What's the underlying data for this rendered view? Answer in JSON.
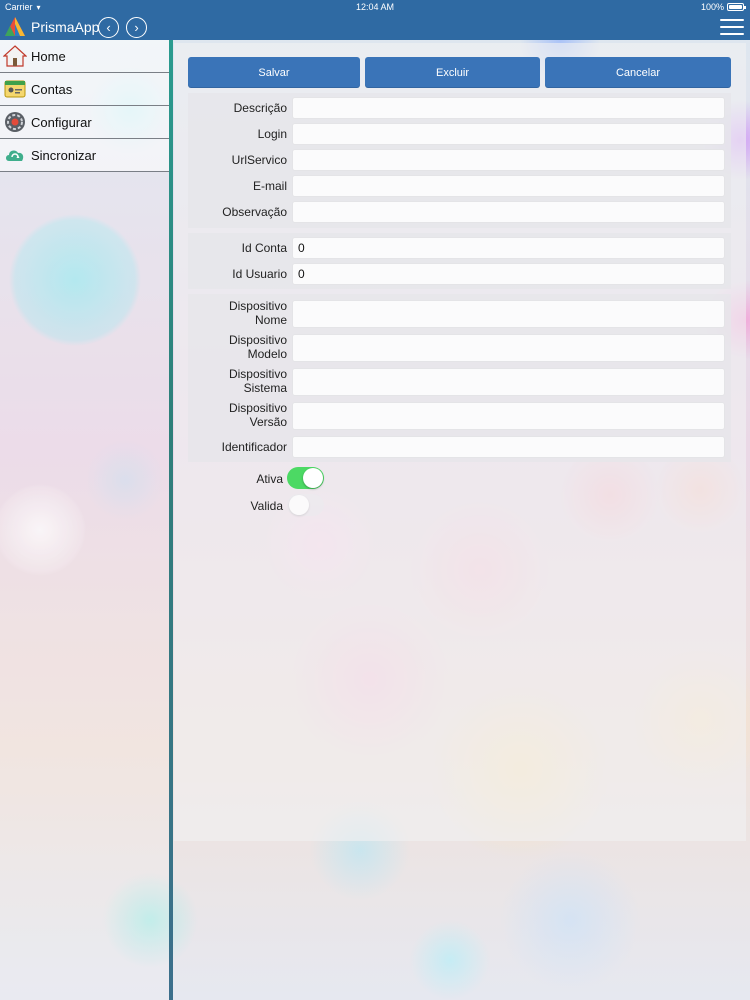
{
  "status_bar": {
    "carrier": "Carrier",
    "time": "12:04 AM",
    "battery": "100%"
  },
  "nav_bar": {
    "title": "PrismaApp"
  },
  "sidebar": {
    "items": [
      {
        "label": "Home",
        "icon": "home-icon"
      },
      {
        "label": "Contas",
        "icon": "accounts-icon"
      },
      {
        "label": "Configurar",
        "icon": "settings-icon"
      },
      {
        "label": "Sincronizar",
        "icon": "cloud-sync-icon"
      }
    ]
  },
  "toolbar": {
    "save_label": "Salvar",
    "delete_label": "Excluir",
    "cancel_label": "Cancelar"
  },
  "form": {
    "account": [
      {
        "label": "Descrição",
        "value": ""
      },
      {
        "label": "Login",
        "value": ""
      },
      {
        "label": "UrlServico",
        "value": ""
      },
      {
        "label": "E-mail",
        "value": ""
      },
      {
        "label": "Observação",
        "value": ""
      }
    ],
    "ids": [
      {
        "label": "Id Conta",
        "value": "0"
      },
      {
        "label": "Id Usuario",
        "value": "0"
      }
    ],
    "device": [
      {
        "label_line1": "Dispositivo",
        "label_line2": "Nome",
        "value": ""
      },
      {
        "label_line1": "Dispositivo",
        "label_line2": "Modelo",
        "value": ""
      },
      {
        "label_line1": "Dispositivo",
        "label_line2": "Sistema",
        "value": ""
      },
      {
        "label_line1": "Dispositivo",
        "label_line2": "Versão",
        "value": ""
      }
    ],
    "identifier": {
      "label": "Identificador",
      "value": ""
    },
    "toggles": [
      {
        "label": "Ativa",
        "on": true
      },
      {
        "label": "Valida",
        "on": false
      }
    ]
  },
  "colors": {
    "nav_bar": "#2f6aa3",
    "button": "#3a74b8",
    "switch_on": "#4cd964"
  }
}
